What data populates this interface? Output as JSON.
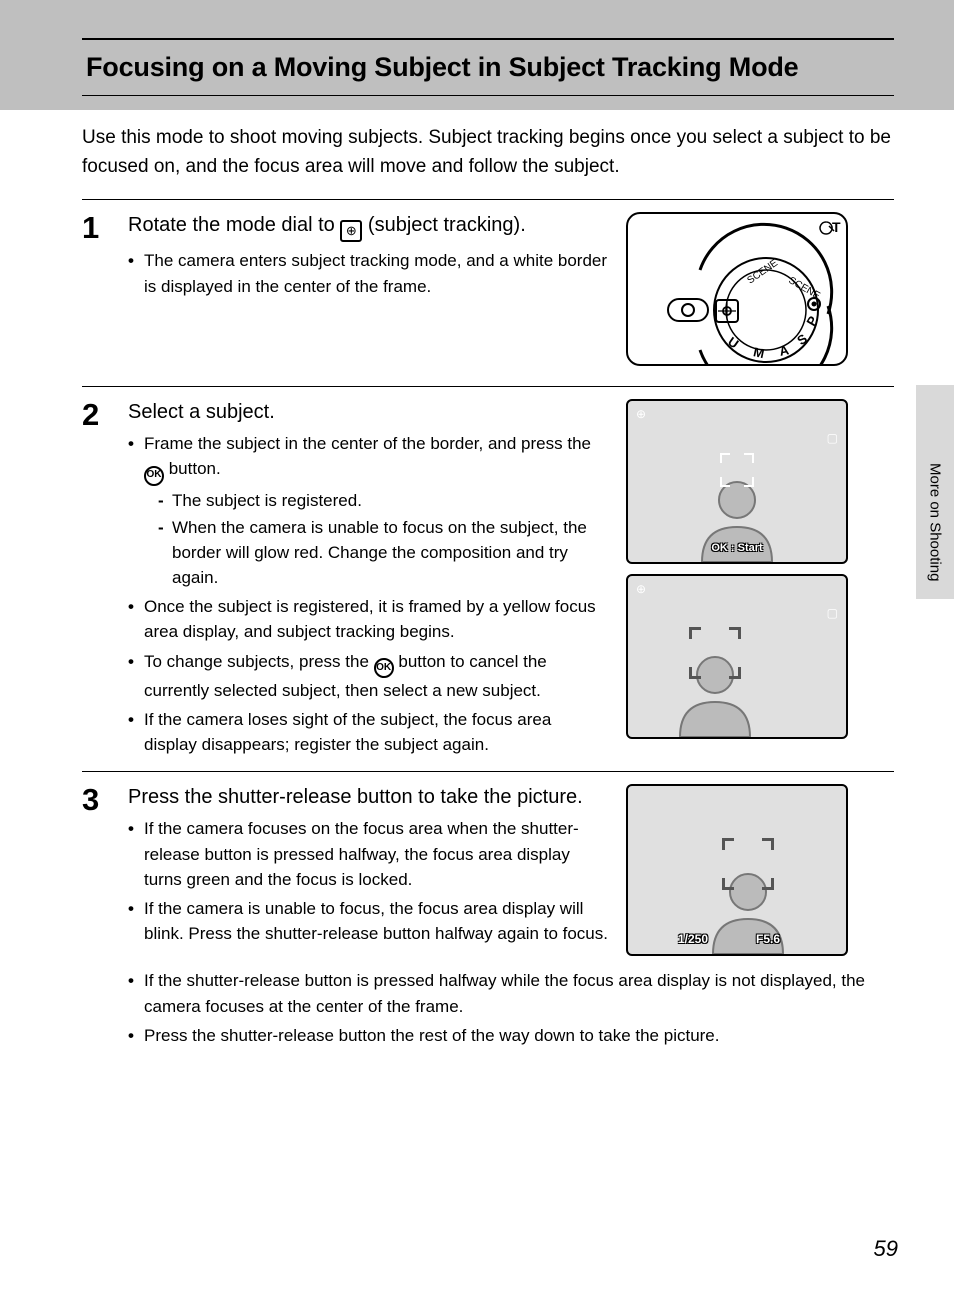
{
  "title": "Focusing on a Moving Subject in Subject Tracking Mode",
  "intro": "Use this mode to shoot moving subjects. Subject tracking begins once you select a subject to be focused on, and the focus area will move and follow the subject.",
  "sidebar_label": "More on Shooting",
  "page_number": "59",
  "step1": {
    "num": "1",
    "head_pre": "Rotate the mode dial to ",
    "head_post": " (subject tracking).",
    "b1": "The camera enters subject tracking mode, and a white border is displayed in the center of the frame."
  },
  "step2": {
    "num": "2",
    "head": "Select a subject.",
    "b1_pre": "Frame the subject in the center of the border, and press the ",
    "b1_post": " button.",
    "s1": "The subject is registered.",
    "s2": "When the camera is unable to focus on the subject, the border will glow red. Change the composition and try again.",
    "b2": "Once the subject is registered, it is framed by a yellow focus area display, and subject tracking begins.",
    "b3_pre": "To change subjects, press the ",
    "b3_post": " button to cancel the currently selected subject, then select a new subject.",
    "b4": "If the camera loses sight of the subject, the focus area display disappears; register the subject again.",
    "screen1_label": "OK : Start"
  },
  "step3": {
    "num": "3",
    "head": "Press the shutter-release button to take the picture.",
    "b1": "If the camera focuses on the focus area when the shutter-release button is pressed halfway, the focus area display turns green and the focus is locked.",
    "b2": "If the camera is unable to focus, the focus area display will blink. Press the shutter-release button halfway again to focus.",
    "b3": "If the shutter-release button is pressed halfway while the focus area display is not displayed, the camera focuses at the center of the frame.",
    "b4": "Press the shutter-release button the rest of the way down to take the picture.",
    "shutter": "1/250",
    "aperture": "F5.6"
  }
}
